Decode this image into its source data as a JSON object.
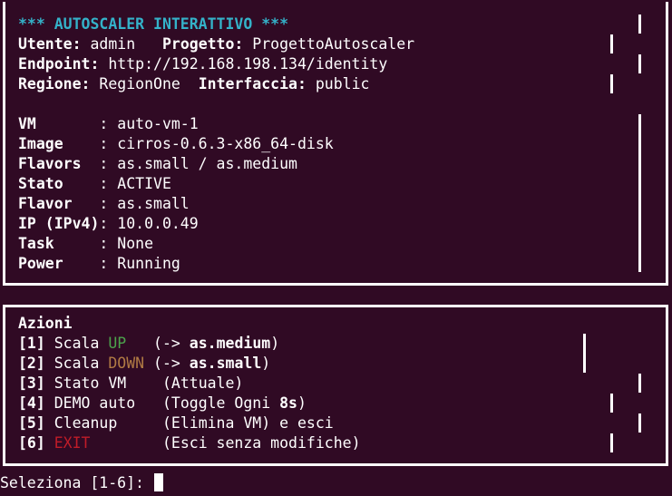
{
  "info": {
    "title": "*** AUTOSCALER INTERATTIVO ***",
    "user_label": "Utente:",
    "user_value": " admin   ",
    "project_label": "Progetto:",
    "project_value": " ProgettoAutoscaler",
    "endpoint_label": "Endpoint:",
    "endpoint_value": " http://192.168.198.134/identity",
    "region_label": "Regione:",
    "region_value": " RegionOne  ",
    "interface_label": "Interfaccia:",
    "interface_value": " public",
    "fields": [
      {
        "label": "VM       ",
        "value": ": auto-vm-1"
      },
      {
        "label": "Image    ",
        "value": ": cirros-0.6.3-x86_64-disk"
      },
      {
        "label": "Flavors  ",
        "value": ": as.small / as.medium"
      },
      {
        "label": "Stato    ",
        "value": ": ACTIVE"
      },
      {
        "label": "Flavor   ",
        "value": ": as.small"
      },
      {
        "label": "IP (IPv4)",
        "value": ": 10.0.0.49"
      },
      {
        "label": "Task     ",
        "value": ": None"
      },
      {
        "label": "Power    ",
        "value": ": Running"
      }
    ]
  },
  "actions": {
    "heading": "Azioni",
    "a1": {
      "num": "[1]",
      "pre": " Scala ",
      "word": "UP",
      "post": "   (-> ",
      "bold": "as.medium",
      "end": ")"
    },
    "a2": {
      "num": "[2]",
      "pre": " Scala ",
      "word": "DOWN",
      "post": " (-> ",
      "bold": "as.small",
      "end": ")"
    },
    "a3": {
      "num": "[3]",
      "text": " Stato VM    (Attuale)"
    },
    "a4": {
      "num": "[4]",
      "text": " DEMO auto   (Toggle Ogni ",
      "bold": "8s",
      "end": ")"
    },
    "a5": {
      "num": "[5]",
      "text": " Cleanup     (Elimina VM) e esci"
    },
    "a6": {
      "num": "[6]",
      "word": " EXIT",
      "text": "        (Esci senza modifiche)"
    }
  },
  "prompt": {
    "text": "Seleziona [1-6]: "
  },
  "colors": {
    "background": "#300a24",
    "title": "#34b2c9",
    "up": "#4ca34c",
    "down": "#b07a44",
    "exit": "#c01c28"
  }
}
